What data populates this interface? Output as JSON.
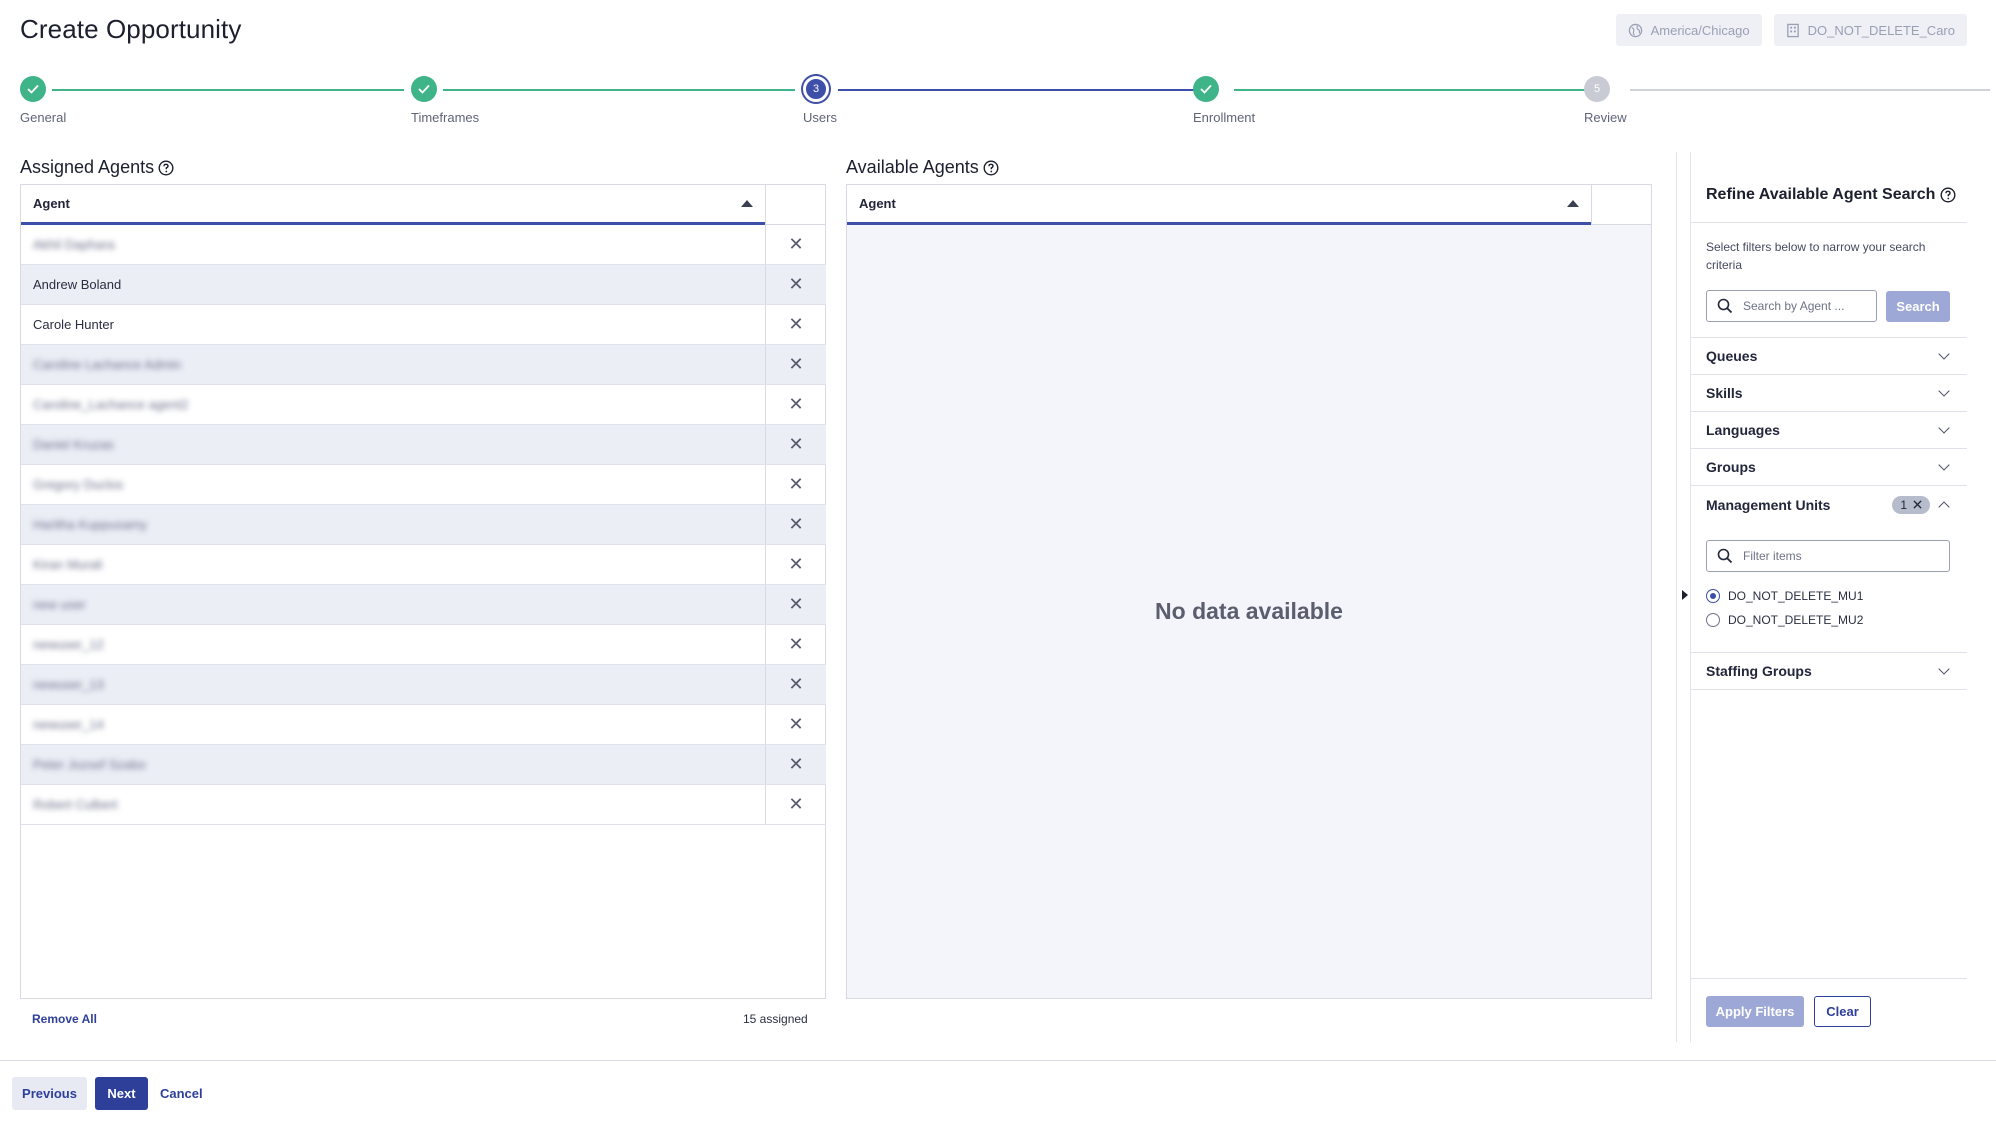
{
  "page_title": "Create Opportunity",
  "top_chips": {
    "timezone": "America/Chicago",
    "business_unit": "DO_NOT_DELETE_Caro"
  },
  "stepper": {
    "steps": [
      {
        "label": "General",
        "state": "done"
      },
      {
        "label": "Timeframes",
        "state": "done"
      },
      {
        "label": "Users",
        "state": "current",
        "number": "3"
      },
      {
        "label": "Enrollment",
        "state": "done"
      },
      {
        "label": "Review",
        "state": "future",
        "number": "5"
      }
    ],
    "colors": {
      "done": "#3fb489",
      "current": "#3d4fa8",
      "future": "#c8cad4"
    }
  },
  "assigned": {
    "title": "Assigned Agents",
    "column_header": "Agent",
    "rows": [
      {
        "name": "Akhil Daphara",
        "blurred": true
      },
      {
        "name": "Andrew Boland",
        "blurred": false
      },
      {
        "name": "Carole Hunter",
        "blurred": false
      },
      {
        "name": "Caroline Lachance Admin",
        "blurred": true
      },
      {
        "name": "Caroline_Lachance agent2",
        "blurred": true
      },
      {
        "name": "Daniel Kruzas",
        "blurred": true
      },
      {
        "name": "Gregory Duclos",
        "blurred": true
      },
      {
        "name": "Haritha Kuppusamy",
        "blurred": true
      },
      {
        "name": "Kiran Murali",
        "blurred": true
      },
      {
        "name": "new user",
        "blurred": true
      },
      {
        "name": "newuser_12",
        "blurred": true
      },
      {
        "name": "newuser_13",
        "blurred": true
      },
      {
        "name": "newuser_14",
        "blurred": true
      },
      {
        "name": "Peter Jozsef Szabo",
        "blurred": true
      },
      {
        "name": "Robert Culbert",
        "blurred": true
      }
    ],
    "remove_icon": "close-icon",
    "remove_glyph": "✕",
    "remove_all_label": "Remove All",
    "assigned_count_text": "15 assigned"
  },
  "available": {
    "title": "Available Agents",
    "column_header": "Agent",
    "empty_text": "No data available"
  },
  "filters": {
    "title": "Refine Available Agent Search",
    "description": "Select filters below to narrow your search criteria",
    "search_placeholder": "Search by Agent ...",
    "search_button": "Search",
    "sections": [
      {
        "label": "Queues",
        "expanded": false
      },
      {
        "label": "Skills",
        "expanded": false
      },
      {
        "label": "Languages",
        "expanded": false
      },
      {
        "label": "Groups",
        "expanded": false
      },
      {
        "label": "Management Units",
        "expanded": true,
        "badge_count": "1"
      },
      {
        "label": "Staffing Groups",
        "expanded": false
      }
    ],
    "filter_items_placeholder": "Filter items",
    "management_units": [
      {
        "label": "DO_NOT_DELETE_MU1",
        "selected": true
      },
      {
        "label": "DO_NOT_DELETE_MU2",
        "selected": false
      }
    ],
    "apply_label": "Apply Filters",
    "clear_label": "Clear"
  },
  "footer": {
    "previous_label": "Previous",
    "next_label": "Next",
    "cancel_label": "Cancel"
  }
}
